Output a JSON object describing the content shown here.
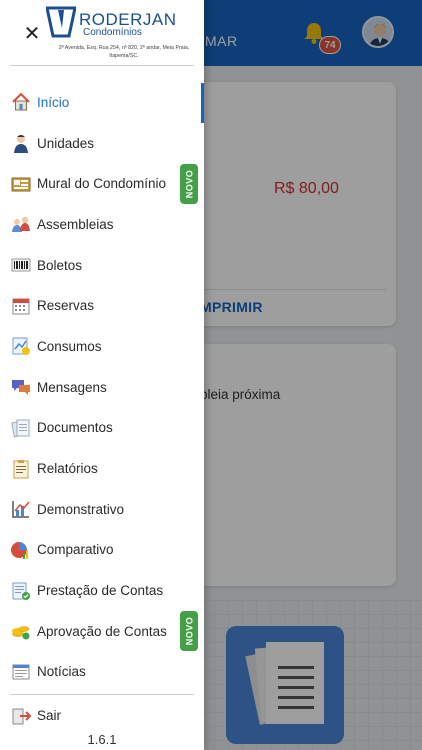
{
  "header": {
    "partial_text": "MAR",
    "notifications_count": "74"
  },
  "cards": {
    "amount": "R$ 80,00",
    "print_label": "MPRIMIR",
    "assembly_text": "bleia próxima"
  },
  "drawer": {
    "logo_name": "RODERJAN",
    "logo_subtitle": "Condomínios",
    "logo_address": "2ª Avenida, Esq. Rua 254, nº 820, 2º andar, Meia Praia, Itapema/SC.",
    "new_badge": "NOVO",
    "items": [
      {
        "label": "Início",
        "icon": "home-icon",
        "active": true
      },
      {
        "label": "Unidades",
        "icon": "person-icon"
      },
      {
        "label": "Mural do Condomínio",
        "icon": "board-icon",
        "badge": true
      },
      {
        "label": "Assembleias",
        "icon": "people-icon"
      },
      {
        "label": "Boletos",
        "icon": "barcode-icon"
      },
      {
        "label": "Reservas",
        "icon": "calendar-icon"
      },
      {
        "label": "Consumos",
        "icon": "meter-icon"
      },
      {
        "label": "Mensagens",
        "icon": "chat-icon"
      },
      {
        "label": "Documentos",
        "icon": "documents-icon"
      },
      {
        "label": "Relatórios",
        "icon": "report-icon"
      },
      {
        "label": "Demonstrativo",
        "icon": "chart-icon"
      },
      {
        "label": "Comparativo",
        "icon": "compare-icon"
      },
      {
        "label": "Prestação de Contas",
        "icon": "accounts-icon"
      },
      {
        "label": "Aprovação de Contas",
        "icon": "coins-icon",
        "badge": true
      },
      {
        "label": "Notícias",
        "icon": "news-icon"
      }
    ],
    "logout_label": "Sair",
    "version": "1.6.1"
  },
  "colors": {
    "primary": "#1565c0",
    "active_text": "#1e6fc9",
    "badge_green": "#43a047",
    "amount_red": "#d32f2f"
  }
}
